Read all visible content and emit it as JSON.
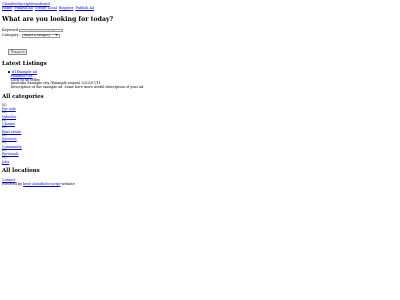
{
  "header": {
    "brand": "Classifiedsscriptdemoboard",
    "nav": [
      "Home",
      "Publish Ad",
      "Create Local",
      "Register",
      "Publish Ad"
    ]
  },
  "search": {
    "heading": "What are you looking for today?",
    "keyword_label": "Keyword",
    "keyword_placeholder": "e.g. Ad, Keyword or Zip",
    "category_label": "Category",
    "category_value": "Select a category",
    "button_label": "Search"
  },
  "latest": {
    "heading": "Latest Listings",
    "items": [
      {
        "title": "#1Example ad",
        "category": "Example Cat",
        "seller": "Click to do seller",
        "meta": "Australia Example city (Example region) 2022/07/11",
        "description": "Description of the example ad. Some here more useful description of your ad."
      }
    ]
  },
  "categories": {
    "heading": "All categories",
    "items": [
      {
        "count": "(0)",
        "name": "For sale"
      },
      {
        "count": "(0)",
        "name": "Vehicles"
      },
      {
        "count": "(0)",
        "name": "Classes"
      },
      {
        "count": "(0)",
        "name": "Real estate"
      },
      {
        "count": "(0)",
        "name": "Services"
      },
      {
        "count": "(0)",
        "name": "Community"
      },
      {
        "count": "(0)",
        "name": "Personals"
      },
      {
        "count": "(0)",
        "name": "Jobs"
      }
    ]
  },
  "locations": {
    "heading": "All locations"
  },
  "footer": {
    "contact": "Contact",
    "powered_prefix": "Powered by",
    "powered_link": "best-classifieds-script",
    "powered_suffix": "website"
  },
  "icons": {
    "select": "chevron-down-icon",
    "search": "magnifier-icon",
    "bullet": "disc-bullet"
  }
}
